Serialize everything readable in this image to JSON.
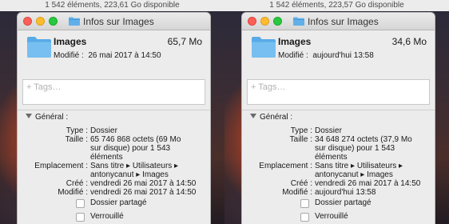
{
  "panels": [
    {
      "statusbar": "1 542 éléments, 223,61 Go disponible",
      "title": "Infos sur Images",
      "name": "Images",
      "size": "65,7 Mo",
      "modified_label": "Modifié :",
      "modified_value": "26 mai 2017 à 14:50",
      "tags_placeholder": "+ Tags…",
      "section": "Général :",
      "type_label": "Type :",
      "type_value": "Dossier",
      "taille_label": "Taille :",
      "taille_lines": [
        "65 746 868 octets (69 Mo",
        "sur disque) pour 1 543",
        "éléments"
      ],
      "emplacement_label": "Emplacement :",
      "emplacement_lines": [
        "Sans titre ▸ Utilisateurs ▸",
        "antonycanut ▸ Images"
      ],
      "cree_label": "Créé :",
      "cree_value": "vendredi 26 mai 2017 à 14:50",
      "modifie_label": "Modifié :",
      "modifie_value": "vendredi 26 mai 2017 à 14:50",
      "dossier_partage": "Dossier partagé",
      "verrouille": "Verrouillé"
    },
    {
      "statusbar": "1 542 éléments, 223,57 Go disponible",
      "title": "Infos sur Images",
      "name": "Images",
      "size": "34,6 Mo",
      "modified_label": "Modifié :",
      "modified_value": "aujourd'hui 13:58",
      "tags_placeholder": "+ Tags…",
      "section": "Général :",
      "type_label": "Type :",
      "type_value": "Dossier",
      "taille_label": "Taille :",
      "taille_lines": [
        "34 648 274 octets (37,9 Mo",
        "sur disque) pour 1 543",
        "éléments"
      ],
      "emplacement_label": "Emplacement :",
      "emplacement_lines": [
        "Sans titre ▸ Utilisateurs ▸",
        "antonycanut ▸ Images"
      ],
      "cree_label": "Créé :",
      "cree_value": "vendredi 26 mai 2017 à 14:50",
      "modifie_label": "Modifié :",
      "modifie_value": "aujourd'hui 13:58",
      "dossier_partage": "Dossier partagé",
      "verrouille": "Verrouillé"
    }
  ],
  "colors": {
    "folder_blue": "#5fb0ea",
    "close_red": "#fc5f57",
    "minimize_yellow": "#fdbc2e",
    "zoom_green": "#28c840"
  }
}
